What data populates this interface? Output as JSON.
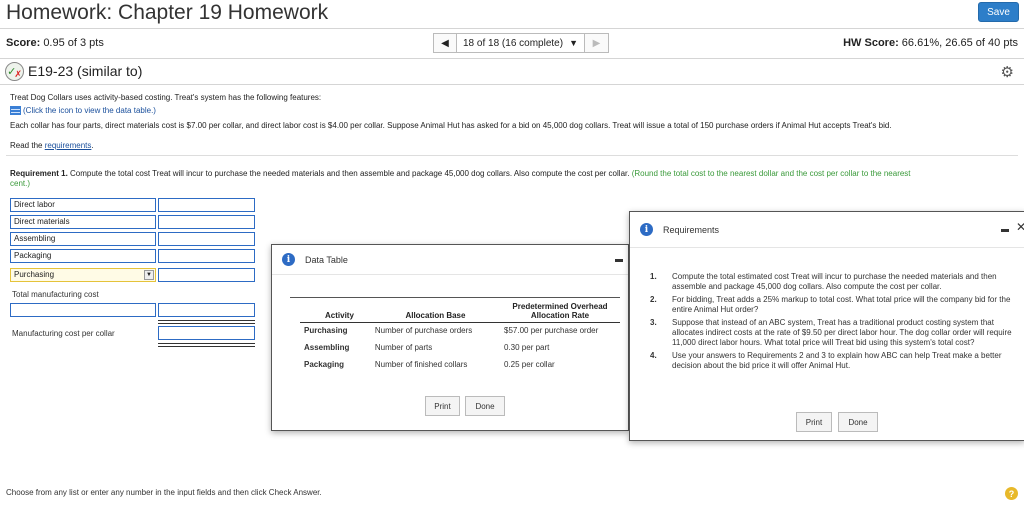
{
  "header": {
    "title": "Homework: Chapter 19 Homework",
    "save_label": "Save"
  },
  "status": {
    "score_label": "Score:",
    "score_value": "0.95 of 3 pts",
    "nav_label": "18 of 18 (16 complete)",
    "hw_label": "HW Score:",
    "hw_value": "66.61%, 26.65 of 40 pts"
  },
  "question": {
    "title": "E19-23 (similar to)",
    "line1": "Treat Dog Collars uses activity-based costing. Treat's system has the following features:",
    "data_link": "(Click the icon to view the data table.)",
    "line2": "Each collar has four parts, direct materials cost is $7.00 per collar, and direct labor cost is $4.00 per collar. Suppose Animal Hut has asked for a bid on 45,000 dog collars. Treat will issue a total of 150 purchase orders if Animal Hut accepts Treat's bid.",
    "read_prefix": "Read the ",
    "read_link": "requirements",
    "read_suffix": ".",
    "req1_bold": "Requirement 1.",
    "req1_text": " Compute the total cost Treat will incur to purchase the needed materials and then assemble and package 45,000 dog collars. Also compute the cost per collar.",
    "req1_hint": " (Round the total cost to the nearest dollar and the cost per collar to the nearest",
    "req1_hint2": "cent.)"
  },
  "form": {
    "rows": [
      "Direct labor",
      "Direct materials",
      "Assembling",
      "Packaging"
    ],
    "selected": "Purchasing",
    "total_label": "Total manufacturing cost",
    "per_collar_label": "Manufacturing cost per collar"
  },
  "data_dialog": {
    "title": "Data Table",
    "headers": [
      "Activity",
      "Allocation Base",
      "Predetermined Overhead Allocation Rate"
    ],
    "rows": [
      [
        "Purchasing",
        "Number of purchase orders",
        "$57.00 per purchase order"
      ],
      [
        "Assembling",
        "Number of parts",
        "0.30 per part"
      ],
      [
        "Packaging",
        "Number of finished collars",
        "0.25 per collar"
      ]
    ],
    "print": "Print",
    "done": "Done"
  },
  "req_dialog": {
    "title": "Requirements",
    "items": [
      {
        "n": "1.",
        "text": "Compute the total estimated cost Treat will incur to purchase the needed materials and then assemble and package 45,000 dog collars. Also compute the cost per collar."
      },
      {
        "n": "2.",
        "text": "For bidding, Treat adds a 25% markup to total cost. What total price will the company bid for the entire Animal Hut order?"
      },
      {
        "n": "3.",
        "text": "Suppose that instead of an ABC system, Treat has a traditional product costing system that allocates indirect costs at the rate of $9.50 per direct labor hour. The dog collar order will require 11,000 direct labor hours. What total price will Treat bid using this system's total cost?"
      },
      {
        "n": "4.",
        "text": "Use your answers to Requirements 2 and 3 to explain how ABC can help Treat make a better decision about the bid price it will offer Animal Hut."
      }
    ],
    "print": "Print",
    "done": "Done"
  },
  "footer": {
    "text": "Choose from any list or enter any number in the input fields and then click Check Answer.",
    "help": "?"
  }
}
